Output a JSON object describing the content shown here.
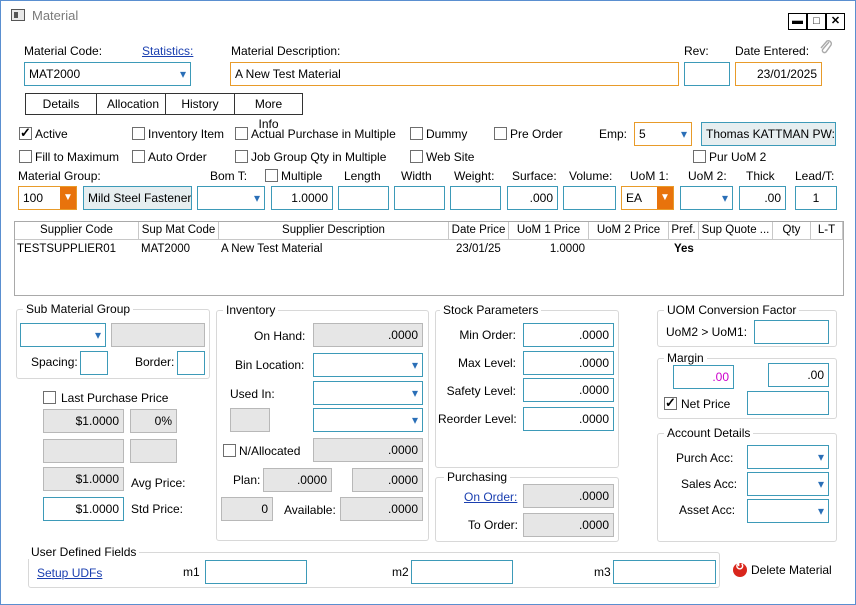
{
  "window": {
    "title": "Material"
  },
  "header": {
    "material_code_label": "Material Code:",
    "statistics_link": "Statistics:",
    "material_code": "MAT2000",
    "description_label": "Material Description:",
    "description": "A New Test Material",
    "rev_label": "Rev:",
    "rev": "",
    "date_entered_label": "Date Entered:",
    "date_entered": "23/01/2025"
  },
  "tabs": [
    "Details",
    "Allocation",
    "History",
    "More Info"
  ],
  "options": {
    "active": "Active",
    "inventory_item": "Inventory Item",
    "actual_purchase": "Actual Purchase in Multiple",
    "dummy": "Dummy",
    "pre_order": "Pre Order",
    "emp_label": "Emp:",
    "emp_value": "5",
    "emp_name": "Thomas KATTMAN PW:",
    "fill_to_max": "Fill to Maximum",
    "auto_order": "Auto Order",
    "job_group_qty": "Job Group Qty in Multiple",
    "web_site": "Web Site",
    "pur_uom2": "Pur UoM 2"
  },
  "row3": {
    "material_group_label": "Material Group:",
    "material_group_code": "100",
    "material_group_name": "Mild Steel Fasteners",
    "bom_label": "Bom T:",
    "multiple_label": "Multiple",
    "multiple_value": "1.0000",
    "length_label": "Length",
    "width_label": "Width",
    "weight_label": "Weight:",
    "surface_label": "Surface:",
    "surface_value": ".000",
    "volume_label": "Volume:",
    "uom1_label": "UoM 1:",
    "uom1_value": "EA",
    "uom2_label": "UoM 2:",
    "thick_label": "Thick",
    "thick_value": ".00",
    "leadtime_label": "Lead/T:",
    "leadtime_value": "1"
  },
  "supplier_grid": {
    "columns": [
      "Supplier Code",
      "Sup Mat Code",
      "Supplier Description",
      "Date Price",
      "UoM 1 Price",
      "UoM 2 Price",
      "Pref.",
      "Sup Quote ...",
      "Qty",
      "L-T"
    ],
    "rows": [
      {
        "code": "TESTSUPPLIER01",
        "mat_code": "MAT2000",
        "desc": "A New Test Material",
        "date": "23/01/25",
        "uom1": "1.0000",
        "uom2": "",
        "pref": "Yes",
        "quote": "",
        "qty": "",
        "lt": ""
      }
    ]
  },
  "sub_material": {
    "title": "Sub Material Group",
    "spacing_label": "Spacing:",
    "border_label": "Border:",
    "last_purchase_label": "Last Purchase Price",
    "last_price": "$1.0000",
    "last_pct": "0%",
    "avg_price": "$1.0000",
    "avg_label": "Avg Price:",
    "std_price": "$1.0000",
    "std_label": "Std Price:"
  },
  "inventory": {
    "title": "Inventory",
    "on_hand_label": "On Hand:",
    "on_hand": ".0000",
    "bin_label": "Bin Location:",
    "used_in_label": "Used In:",
    "nallocated_label": "N/Allocated",
    "nallocated": ".0000",
    "plan_label": "Plan:",
    "plan1": ".0000",
    "plan2": ".0000",
    "avail_count": "0",
    "available_label": "Available:",
    "available": ".0000"
  },
  "stock": {
    "title": "Stock Parameters",
    "min_label": "Min Order:",
    "min": ".0000",
    "max_label": "Max Level:",
    "max": ".0000",
    "safety_label": "Safety Level:",
    "safety": ".0000",
    "reorder_label": "Reorder Level:",
    "reorder": ".0000"
  },
  "purchasing": {
    "title": "Purchasing",
    "on_order_label": "On Order:",
    "on_order": ".0000",
    "to_order_label": "To Order:",
    "to_order": ".0000"
  },
  "uom_conv": {
    "title": "UOM Conversion Factor",
    "label": "UoM2 > UoM1:"
  },
  "margin": {
    "title": "Margin",
    "value1": ".00",
    "value2": ".00",
    "net_price_label": "Net Price"
  },
  "account": {
    "title": "Account Details",
    "purch_label": "Purch Acc:",
    "sales_label": "Sales Acc:",
    "asset_label": "Asset Acc:"
  },
  "udf": {
    "title": "User Defined Fields",
    "setup_link": "Setup UDFs",
    "m1_label": "m1",
    "m2_label": "m2",
    "m3_label": "m3"
  },
  "delete_label": "Delete Material",
  "colors": {
    "accent_border": "#3d9ab8",
    "orange": "#e8730c",
    "link": "#1a3fb0",
    "magenta": "#cc00cc"
  }
}
